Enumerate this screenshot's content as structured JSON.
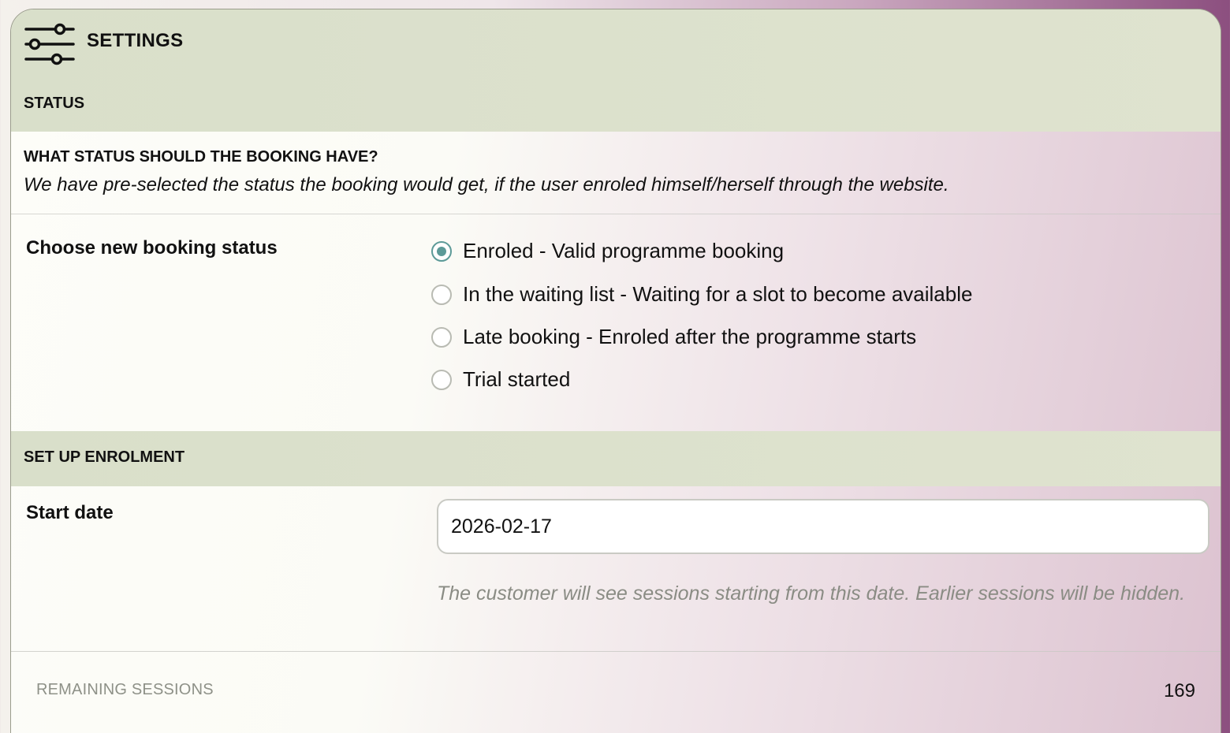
{
  "header": {
    "title": "SETTINGS",
    "icon": "sliders-icon"
  },
  "status_section": {
    "label": "STATUS",
    "question": "WHAT STATUS SHOULD THE BOOKING HAVE?",
    "description": "We have pre-selected the status the booking would get, if the user enroled himself/herself through the website.",
    "field_label": "Choose new booking status",
    "options": [
      {
        "label": "Enroled - Valid programme booking",
        "checked": true
      },
      {
        "label": "In the waiting list - Waiting for a slot to become available",
        "checked": false
      },
      {
        "label": "Late booking - Enroled after the programme starts",
        "checked": false
      },
      {
        "label": "Trial started",
        "checked": false
      }
    ]
  },
  "enrolment_section": {
    "label": "SET UP ENROLMENT",
    "start_date_label": "Start date",
    "start_date_value": "2026-02-17",
    "help_text": "The customer will see sessions starting from this date. Earlier sessions will be hidden.",
    "remaining_label": "REMAINING SESSIONS",
    "remaining_value": "169"
  },
  "colors": {
    "accent": "#5c9a98",
    "band": "#dde2cd"
  }
}
